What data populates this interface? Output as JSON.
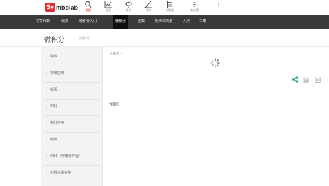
{
  "header": {
    "logo_badge": "Sy",
    "logo_text": "mbolab",
    "nav": [
      {
        "label": "解题",
        "icon": "search-icon",
        "active": true
      },
      {
        "label": "图表",
        "icon": "chart-icon",
        "active": false
      },
      {
        "label": "练习",
        "icon": "lightbulb-icon",
        "active": false
      },
      {
        "label": "几何",
        "icon": "angle-icon",
        "active": false
      },
      {
        "label": "计算器",
        "icon": "calculator-icon",
        "active": false
      },
      {
        "label": "笔记簿",
        "icon": "notebook-icon",
        "active": false
      }
    ],
    "more_icon": "⋮"
  },
  "categories": [
    {
      "label": "初等代数",
      "active": false
    },
    {
      "label": "代数",
      "active": false
    },
    {
      "label": "微积分入门",
      "active": false
    },
    {
      "label": "微积分",
      "active": true
    },
    {
      "label": "函数",
      "active": false
    },
    {
      "label": "矩阵和向量",
      "active": false
    },
    {
      "label": "几何",
      "active": false
    },
    {
      "label": "三角",
      "active": false
    }
  ],
  "page": {
    "title": "微积分",
    "subtitle": "微积分"
  },
  "sidebar": {
    "items": [
      {
        "label": "导数"
      },
      {
        "label": "导数应用"
      },
      {
        "label": "极限"
      },
      {
        "label": "积分"
      },
      {
        "label": "积分应用"
      },
      {
        "label": "级数"
      },
      {
        "label": "ODE（常微分方程）"
      },
      {
        "label": "拉普拉斯变换"
      }
    ]
  },
  "main": {
    "keyboard_toggle": "大键盘 ▾",
    "examples_label": "例题"
  },
  "colors": {
    "brand_red": "#e02d2d",
    "share_green": "#2aa784",
    "nav_dark": "#3a3a3a"
  }
}
